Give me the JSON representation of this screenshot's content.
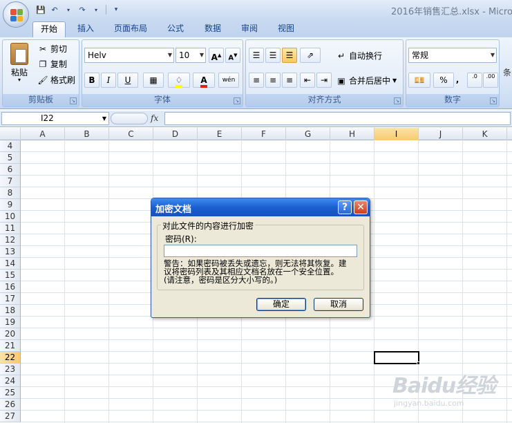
{
  "window": {
    "title": "2016年销售汇总.xlsx - Micro"
  },
  "tabs": [
    {
      "label": "开始",
      "active": true
    },
    {
      "label": "插入"
    },
    {
      "label": "页面布局"
    },
    {
      "label": "公式"
    },
    {
      "label": "数据"
    },
    {
      "label": "审阅"
    },
    {
      "label": "视图"
    }
  ],
  "ribbon": {
    "clipboard": {
      "paste": "粘贴",
      "cut": "剪切",
      "copy": "复制",
      "format_painter": "格式刷",
      "label": "剪贴板"
    },
    "font": {
      "name": "Helv",
      "size": "10",
      "bold": "B",
      "italic": "I",
      "underline": "U",
      "label": "字体",
      "grow": "A",
      "shrink": "A",
      "font_color": "A",
      "phonetic": "wén"
    },
    "alignment": {
      "wrap": "自动换行",
      "merge": "合并后居中",
      "label": "对齐方式"
    },
    "number": {
      "format": "常规",
      "percent": "%",
      "comma": ",",
      "inc_decimal": ".0",
      "dec_decimal": ".00",
      "label": "数字"
    },
    "cut_right": "条"
  },
  "formula_bar": {
    "name_box": "I22",
    "fx": "fx",
    "value": ""
  },
  "grid": {
    "columns": [
      "A",
      "B",
      "C",
      "D",
      "E",
      "F",
      "G",
      "H",
      "I",
      "J",
      "K"
    ],
    "selected_column": "I",
    "rows": [
      "4",
      "5",
      "6",
      "7",
      "8",
      "9",
      "10",
      "11",
      "12",
      "13",
      "14",
      "15",
      "16",
      "17",
      "18",
      "19",
      "20",
      "21",
      "22",
      "23",
      "24",
      "25",
      "26",
      "27"
    ],
    "selected_row": "22",
    "active_cell": "I22"
  },
  "dialog": {
    "title": "加密文档",
    "help": "?",
    "close": "✕",
    "group_title": "对此文件的内容进行加密",
    "password_label": "密码(R):",
    "password_value": "",
    "warning_1": "警告：如果密码被丢失或遗忘，则无法将其恢复。建",
    "warning_2": "议将密码列表及其相应文档名放在一个安全位置。",
    "warning_3": "(请注意，密码是区分大小写的。)",
    "ok": "确定",
    "cancel": "取消"
  },
  "watermark": {
    "text": "Baidu经验",
    "url": "jingyan.baidu.com"
  }
}
